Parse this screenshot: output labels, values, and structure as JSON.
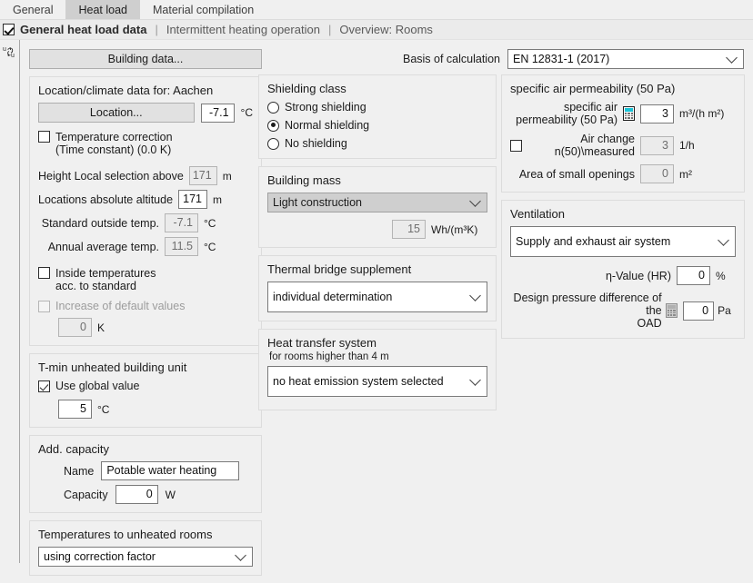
{
  "tabs": [
    {
      "label": "General",
      "active": false
    },
    {
      "label": "Heat load",
      "active": true
    },
    {
      "label": "Material compilation",
      "active": false
    }
  ],
  "header": {
    "title": "General heat load data",
    "separator": "|",
    "link_intermittent": "Intermittent heating operation",
    "link_overview": "Overview: Rooms"
  },
  "gutter": {
    "icon_label": "u-cycle-icon"
  },
  "basis": {
    "label": "Basis of calculation",
    "value": "EN 12831-1 (2017)"
  },
  "building_data_button": "Building data...",
  "location": {
    "title": "Location/climate data for: Aachen",
    "location_button": "Location...",
    "design_temp_value": "-7.1",
    "design_temp_unit": "°C",
    "temp_correction_label_line1": "Temperature correction",
    "temp_correction_label_line2": "(Time constant) (0.0 K)",
    "fields": [
      {
        "label": "Height Local selection above",
        "value": "171",
        "unit": "m",
        "disabled": true
      },
      {
        "label": "Locations absolute altitude",
        "value": "171",
        "unit": "m",
        "disabled": false
      },
      {
        "label": "Standard outside temp.",
        "value": "-7.1",
        "unit": "°C",
        "disabled": true
      },
      {
        "label": "Annual average temp.",
        "value": "11.5",
        "unit": "°C",
        "disabled": true
      }
    ],
    "inside_temps_line1": "Inside temperatures",
    "inside_temps_line2": "acc. to standard",
    "increase_defaults_label": "Increase of default values",
    "increase_defaults_value": "0",
    "increase_defaults_unit": "K"
  },
  "tmin": {
    "title": "T-min unheated building unit",
    "use_global_label": "Use global value",
    "value": "5",
    "unit": "°C"
  },
  "add_capacity": {
    "title": "Add. capacity",
    "name_label": "Name",
    "name_value": "Potable water heating",
    "capacity_label": "Capacity",
    "capacity_value": "0",
    "capacity_unit": "W"
  },
  "temps_unheated": {
    "title": "Temperatures to unheated rooms",
    "value": "using correction factor"
  },
  "shielding": {
    "title": "Shielding class",
    "options": [
      {
        "label": "Strong shielding",
        "selected": false
      },
      {
        "label": "Normal shielding",
        "selected": true
      },
      {
        "label": "No shielding",
        "selected": false
      }
    ]
  },
  "building_mass": {
    "title": "Building mass",
    "value": "Light construction",
    "number": "15",
    "unit": "Wh/(m³K)"
  },
  "thermal_bridge": {
    "title": "Thermal bridge supplement",
    "value": "individual determination"
  },
  "heat_transfer": {
    "title": "Heat transfer system",
    "note": "for rooms higher than 4 m",
    "value": "no heat emission system selected"
  },
  "air_permeability": {
    "title": "specific air permeability (50 Pa)",
    "perm_label_line1": "specific air",
    "perm_label_line2": "permeability (50 Pa)",
    "perm_value": "3",
    "perm_unit": "m³/(h m²)",
    "air_change_line1": "Air change",
    "air_change_line2": "n(50)\\measured",
    "air_change_value": "3",
    "air_change_unit": "1/h",
    "small_openings_label": "Area of small openings",
    "small_openings_value": "0",
    "small_openings_unit": "m²"
  },
  "ventilation": {
    "title": "Ventilation",
    "system_value": "Supply and exhaust air system",
    "eta_label": "η-Value (HR)",
    "eta_value": "0",
    "eta_unit": "%",
    "oad_label_line1": "Design pressure difference of the",
    "oad_label_line2": "OAD",
    "oad_value": "0",
    "oad_unit": "Pa"
  }
}
